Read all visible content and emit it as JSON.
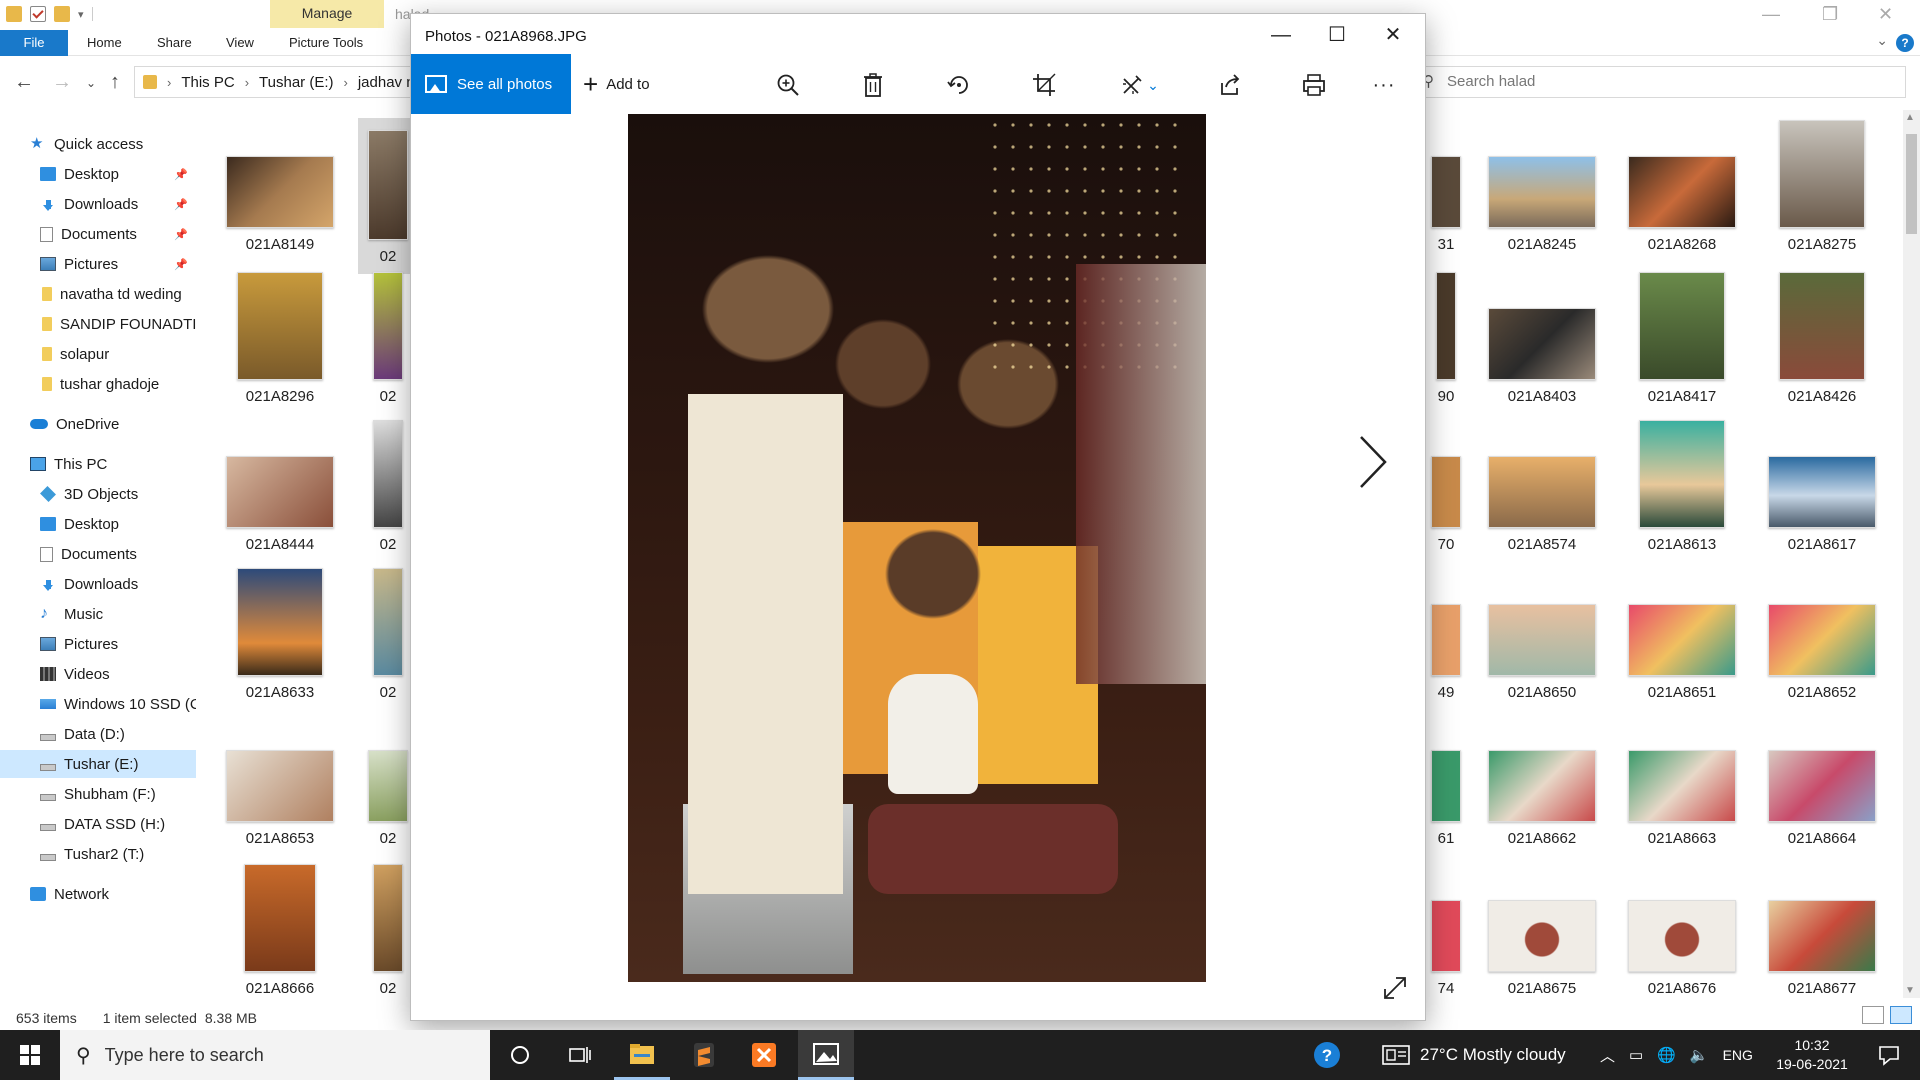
{
  "explorer": {
    "title_hint": "halad",
    "manage_tab": "Manage",
    "ribbon": {
      "file": "File",
      "tabs": [
        "Home",
        "Share",
        "View",
        "Picture Tools"
      ]
    },
    "address": {
      "crumbs": [
        "This PC",
        "Tushar (E:)",
        "jadhav na"
      ]
    },
    "search": {
      "placeholder": "Search halad"
    },
    "nav": {
      "quick_access": "Quick access",
      "quick_items": [
        "Desktop",
        "Downloads",
        "Documents",
        "Pictures",
        "navatha td weding",
        "SANDIP FOUNADTI(",
        "solapur",
        "tushar ghadoje"
      ],
      "onedrive": "OneDrive",
      "this_pc": "This PC",
      "pc_items": [
        "3D Objects",
        "Desktop",
        "Documents",
        "Downloads",
        "Music",
        "Pictures",
        "Videos",
        "Windows 10 SSD (C",
        "Data (D:)",
        "Tushar (E:)",
        "Shubham (F:)",
        "DATA SSD (H:)",
        "Tushar2 (T:)"
      ],
      "network": "Network"
    },
    "files_left": [
      [
        "021A8149",
        "02"
      ],
      [
        "021A8296",
        "02"
      ],
      [
        "021A8444",
        "02"
      ],
      [
        "021A8633",
        "02"
      ],
      [
        "021A8653",
        "02"
      ],
      [
        "021A8666",
        "02"
      ]
    ],
    "files_right": [
      [
        "31",
        "021A8245",
        "021A8268",
        "021A8275"
      ],
      [
        "90",
        "021A8403",
        "021A8417",
        "021A8426"
      ],
      [
        "70",
        "021A8574",
        "021A8613",
        "021A8617"
      ],
      [
        "49",
        "021A8650",
        "021A8651",
        "021A8652"
      ],
      [
        "61",
        "021A8662",
        "021A8663",
        "021A8664"
      ],
      [
        "74",
        "021A8675",
        "021A8676",
        "021A8677"
      ]
    ],
    "status": {
      "count": "653 items",
      "selected": "1 item selected",
      "size": "8.38 MB"
    }
  },
  "photos": {
    "title": "Photos - 021A8968.JPG",
    "see_all": "See all photos",
    "add_to": "Add to",
    "toolbar_icons": [
      "zoom-icon",
      "delete-icon",
      "rotate-icon",
      "crop-icon",
      "edit-icon",
      "share-icon",
      "print-icon",
      "more-icon"
    ]
  },
  "taskbar": {
    "search_placeholder": "Type here to search",
    "weather": "27°C  Mostly cloudy",
    "lang": "ENG",
    "time": "10:32",
    "date": "19-06-2021"
  }
}
